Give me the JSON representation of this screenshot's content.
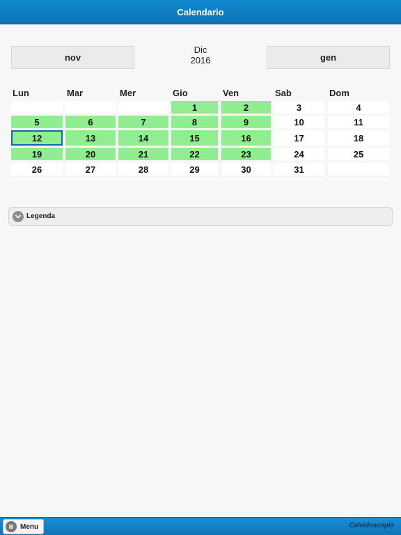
{
  "header": {
    "title": "Calendario"
  },
  "nav": {
    "prev_label": "nov",
    "next_label": "gen",
    "month": "Dic",
    "year": "2016"
  },
  "weekdays": [
    "Lun",
    "Mar",
    "Mer",
    "Gio",
    "Ven",
    "Sab",
    "Dom"
  ],
  "weeks": [
    [
      {
        "day": "",
        "state": "empty"
      },
      {
        "day": "",
        "state": "empty"
      },
      {
        "day": "",
        "state": "empty"
      },
      {
        "day": "1",
        "state": "green"
      },
      {
        "day": "2",
        "state": "green"
      },
      {
        "day": "3",
        "state": "white"
      },
      {
        "day": "4",
        "state": "white"
      }
    ],
    [
      {
        "day": "5",
        "state": "green"
      },
      {
        "day": "6",
        "state": "green"
      },
      {
        "day": "7",
        "state": "green"
      },
      {
        "day": "8",
        "state": "green"
      },
      {
        "day": "9",
        "state": "green"
      },
      {
        "day": "10",
        "state": "white"
      },
      {
        "day": "11",
        "state": "white"
      }
    ],
    [
      {
        "day": "12",
        "state": "green",
        "selected": true
      },
      {
        "day": "13",
        "state": "green"
      },
      {
        "day": "14",
        "state": "green"
      },
      {
        "day": "15",
        "state": "green"
      },
      {
        "day": "16",
        "state": "green"
      },
      {
        "day": "17",
        "state": "white"
      },
      {
        "day": "18",
        "state": "white"
      }
    ],
    [
      {
        "day": "19",
        "state": "green"
      },
      {
        "day": "20",
        "state": "green"
      },
      {
        "day": "21",
        "state": "green"
      },
      {
        "day": "22",
        "state": "green"
      },
      {
        "day": "23",
        "state": "green"
      },
      {
        "day": "24",
        "state": "white"
      },
      {
        "day": "25",
        "state": "white"
      }
    ],
    [
      {
        "day": "26",
        "state": "white"
      },
      {
        "day": "27",
        "state": "white"
      },
      {
        "day": "28",
        "state": "white"
      },
      {
        "day": "29",
        "state": "white"
      },
      {
        "day": "30",
        "state": "white"
      },
      {
        "day": "31",
        "state": "white"
      },
      {
        "day": "",
        "state": "empty"
      }
    ]
  ],
  "legend": {
    "label": "Legenda",
    "icon": "chevron-down-icon"
  },
  "footer": {
    "menu_label": "Menu",
    "menu_icon": "hamburger-icon",
    "brand": "Caleidoscopio"
  },
  "colors": {
    "header": "#0c74b6",
    "workday": "#90ee90",
    "selected_border": "#1265b5"
  }
}
